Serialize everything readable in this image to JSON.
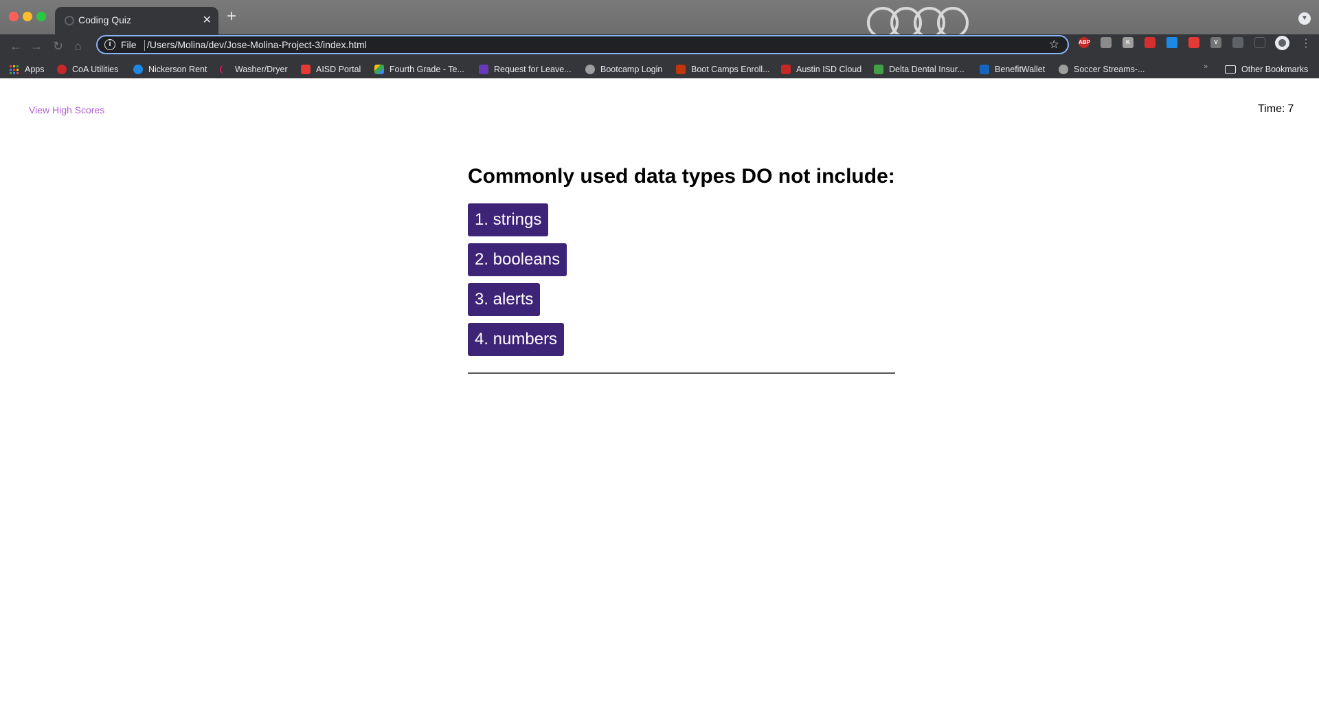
{
  "browser": {
    "tab_title": "Coding Quiz",
    "new_tab": "+",
    "close": "✕",
    "url_scheme": "File",
    "url_path": "/Users/Molina/dev/Jose-Molina-Project-3/index.html",
    "bookmarks": [
      {
        "label": "Apps",
        "icon_color": "#ea4335"
      },
      {
        "label": "CoA Utilities",
        "icon_color": "#c62828"
      },
      {
        "label": "Nickerson Rent",
        "icon_color": "#1e88e5"
      },
      {
        "label": "Washer/Dryer",
        "icon_color": "#d81b60"
      },
      {
        "label": "AISD Portal",
        "icon_color": "#e53935"
      },
      {
        "label": "Fourth Grade - Te...",
        "icon_color": "#fbbc04"
      },
      {
        "label": "Request for Leave...",
        "icon_color": "#673ab7"
      },
      {
        "label": "Bootcamp Login",
        "icon_color": "#9e9e9e"
      },
      {
        "label": "Boot Camps Enroll...",
        "icon_color": "#bf360c"
      },
      {
        "label": "Austin ISD Cloud",
        "icon_color": "#c62828"
      },
      {
        "label": "Delta Dental Insur...",
        "icon_color": "#43a047"
      },
      {
        "label": "BenefitWallet",
        "icon_color": "#1565c0"
      },
      {
        "label": "Soccer Streams-...",
        "icon_color": "#9e9e9e"
      }
    ],
    "other_bookmarks": "Other Bookmarks",
    "extensions": [
      "ABP",
      "",
      "K",
      "",
      "",
      "",
      "V",
      ""
    ]
  },
  "page": {
    "high_scores_link": "View High Scores",
    "timer_label": "Time:",
    "timer_value": "7",
    "question": "Commonly used data types DO not include:",
    "choices": [
      "1. strings",
      "2. booleans",
      "3. alerts",
      "4. numbers"
    ]
  },
  "colors": {
    "choice_bg": "#3d2477",
    "link": "#b05fd1"
  }
}
